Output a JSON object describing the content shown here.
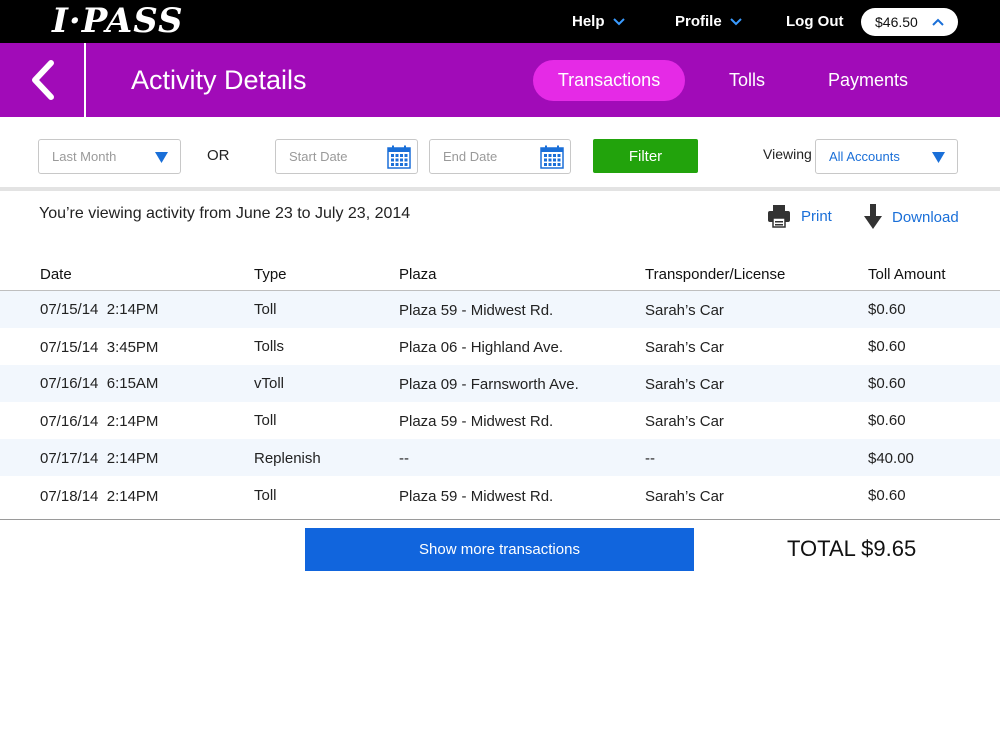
{
  "topbar": {
    "logo": "I·PASS",
    "help_label": "Help",
    "profile_label": "Profile",
    "logout_label": "Log Out",
    "balance": "$46.50"
  },
  "header": {
    "title": "Activity Details",
    "tabs": [
      {
        "label": "Transactions",
        "active": true
      },
      {
        "label": "Tolls",
        "active": false
      },
      {
        "label": "Payments",
        "active": false
      }
    ]
  },
  "filters": {
    "period_placeholder": "Last Month",
    "or_label": "OR",
    "start_date_placeholder": "Start Date",
    "end_date_placeholder": "End Date",
    "filter_label": "Filter",
    "viewing_label": "Viewing",
    "accounts_value": "All Accounts"
  },
  "info": {
    "activity_text": "You’re viewing activity from June 23 to July 23, 2014",
    "print_label": "Print",
    "download_label": "Download"
  },
  "table": {
    "headers": [
      "Date",
      "Type",
      "Plaza",
      "Transponder/License",
      "Toll Amount"
    ],
    "rows": [
      {
        "date": "07/15/14",
        "time": "2:14PM",
        "type": "Toll",
        "plaza": "Plaza 59 - Midwest Rd.",
        "transponder": "Sarah’s Car",
        "amount": "$0.60"
      },
      {
        "date": "07/15/14",
        "time": "3:45PM",
        "type": "Tolls",
        "plaza": "Plaza 06 - Highland Ave.",
        "transponder": "Sarah’s Car",
        "amount": "$0.60"
      },
      {
        "date": "07/16/14",
        "time": "6:15AM",
        "type": "vToll",
        "plaza": "Plaza 09 - Farnsworth Ave.",
        "transponder": "Sarah’s Car",
        "amount": "$0.60"
      },
      {
        "date": "07/16/14",
        "time": "2:14PM",
        "type": "Toll",
        "plaza": "Plaza 59 - Midwest Rd.",
        "transponder": "Sarah’s Car",
        "amount": "$0.60"
      },
      {
        "date": "07/17/14",
        "time": "2:14PM",
        "type": "Replenish",
        "plaza": "--",
        "transponder": "--",
        "amount": "$40.00"
      },
      {
        "date": "07/18/14",
        "time": "2:14PM",
        "type": "Toll",
        "plaza": "Plaza 59 - Midwest Rd.",
        "transponder": "Sarah’s Car",
        "amount": "$0.60"
      }
    ]
  },
  "footer": {
    "show_more_label": "Show more transactions",
    "total": "TOTAL $9.65"
  },
  "colors": {
    "header_purple": "#a10bb8",
    "active_tab_pink": "#e52ae6",
    "filter_green": "#22a30c",
    "link_blue": "#1a6fd8",
    "button_blue": "#1165dd",
    "row_alt": "#f2f7fd"
  }
}
